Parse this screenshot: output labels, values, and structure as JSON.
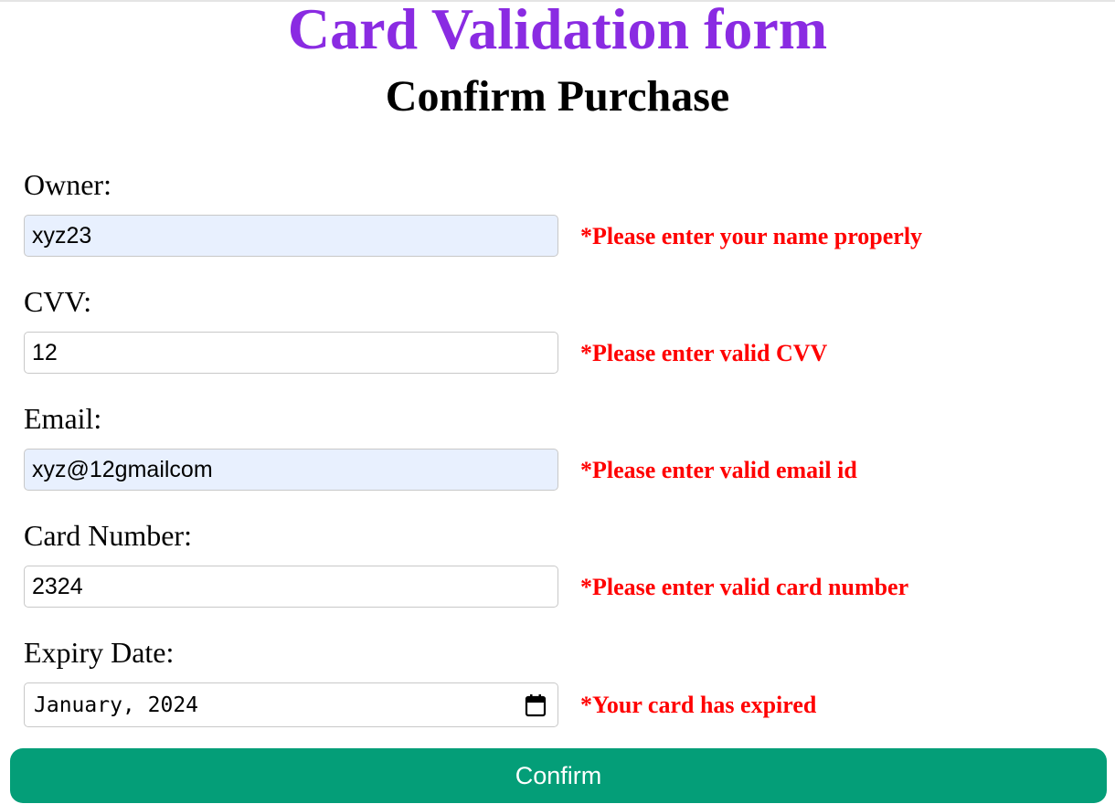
{
  "page": {
    "title": "Card Validation form",
    "subtitle": "Confirm Purchase"
  },
  "colors": {
    "title": "#8a2be2",
    "error": "#ff0000",
    "button": "#049e78",
    "autofill": "#e8f0fe"
  },
  "form": {
    "owner": {
      "label": "Owner:",
      "value": "xyz23",
      "error": "*Please enter your name properly"
    },
    "cvv": {
      "label": "CVV:",
      "value": "12",
      "error": "*Please enter valid CVV"
    },
    "email": {
      "label": "Email:",
      "value": "xyz@12gmailcom",
      "error": "*Please enter valid email id"
    },
    "card_number": {
      "label": "Card Number:",
      "value": "2324",
      "error": "*Please enter valid card number"
    },
    "expiry": {
      "label": "Expiry Date:",
      "value": "January, 2024",
      "icon": "calendar-icon",
      "error": "*Your card has expired"
    },
    "confirm_label": "Confirm"
  }
}
